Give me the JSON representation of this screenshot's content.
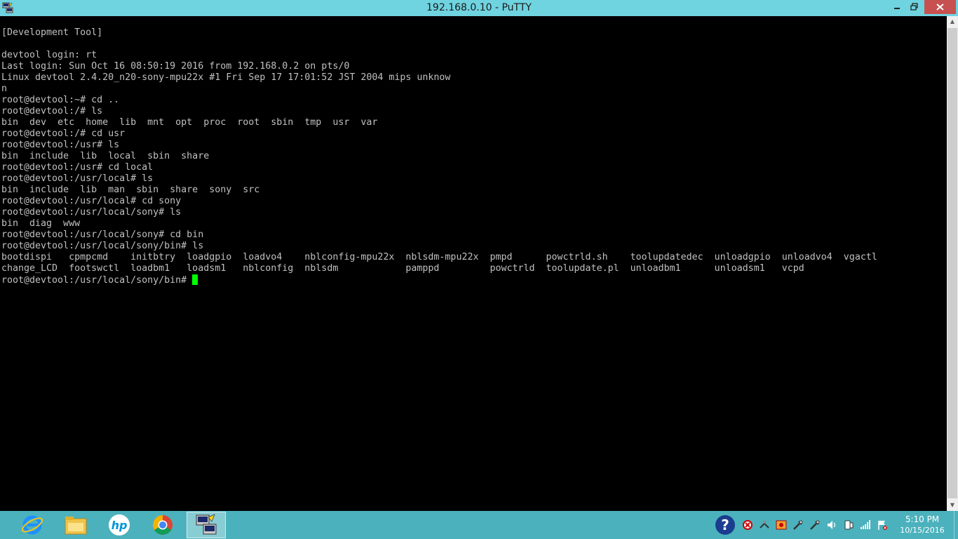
{
  "window": {
    "title": "192.168.0.10 - PuTTY",
    "minimize_glyph": "🗕",
    "maximize_glyph": "🗗",
    "close_glyph": "✕"
  },
  "terminal": {
    "lines": [
      "[Development Tool]",
      "",
      "devtool login: rt",
      "Last login: Sun Oct 16 08:50:19 2016 from 192.168.0.2 on pts/0",
      "Linux devtool 2.4.20_n20-sony-mpu22x #1 Fri Sep 17 17:01:52 JST 2004 mips unknow",
      "n",
      "root@devtool:~# cd ..",
      "root@devtool:/# ls",
      "bin  dev  etc  home  lib  mnt  opt  proc  root  sbin  tmp  usr  var",
      "root@devtool:/# cd usr",
      "root@devtool:/usr# ls",
      "bin  include  lib  local  sbin  share",
      "root@devtool:/usr# cd local",
      "root@devtool:/usr/local# ls",
      "bin  include  lib  man  sbin  share  sony  src",
      "root@devtool:/usr/local# cd sony",
      "root@devtool:/usr/local/sony# ls",
      "bin  diag  www",
      "root@devtool:/usr/local/sony# cd bin",
      "root@devtool:/usr/local/sony/bin# ls",
      "bootdispi   cpmpcmd    initbtry  loadgpio  loadvo4    nblconfig-mpu22x  nblsdm-mpu22x  pmpd      powctrld.sh    toolupdatedec  unloadgpio  unloadvo4  vgactl",
      "change_LCD  footswctl  loadbm1   loadsm1   nblconfig  nblsdm            pamppd         powctrld  toolupdate.pl  unloadbm1      unloadsm1   vcpd"
    ],
    "prompt": "root@devtool:/usr/local/sony/bin# ",
    "cursor_color": "#00ff00",
    "text_color": "#c0c0c0",
    "background": "#000000"
  },
  "taskbar": {
    "apps": [
      {
        "name": "internet-explorer-icon"
      },
      {
        "name": "file-explorer-icon"
      },
      {
        "name": "hp-icon"
      },
      {
        "name": "chrome-icon"
      },
      {
        "name": "putty-icon",
        "active": true
      }
    ],
    "tray_icons": [
      "help-icon",
      "security-alert-icon",
      "network-tools-icon",
      "alert-icon",
      "tool-icon",
      "tool-icon-2",
      "volume-icon",
      "phone-icon",
      "signal-icon",
      "flag-icon"
    ],
    "clock": {
      "time": "5:10 PM",
      "date": "10/15/2016"
    },
    "color": "#4bb2bd"
  }
}
